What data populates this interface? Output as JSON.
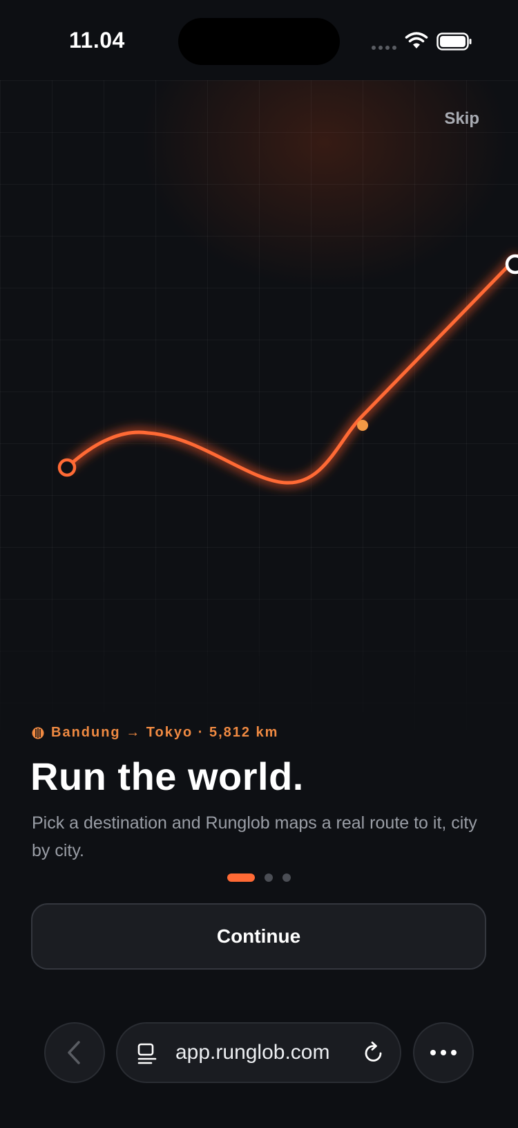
{
  "status_bar": {
    "time": "11.04"
  },
  "header": {
    "skip_label": "Skip"
  },
  "onboarding": {
    "route_meta": "Bandung → Tokyo · 5,812 km",
    "headline": "Run the world.",
    "description": "Pick a destination and Runglob maps a real route to it, city by city.",
    "pager": {
      "total_pages": 3,
      "current_page": 1
    },
    "continue_label": "Continue"
  },
  "browser": {
    "url": "app.runglob.com",
    "icons": {
      "back": "chevron-left-icon",
      "tabs": "tabs-icon",
      "reload": "reload-icon",
      "more": "ellipsis-icon"
    }
  },
  "colors": {
    "accent": "#ff6a35",
    "accent_text": "#f08a42",
    "background": "#0e1014",
    "button_bg": "#1b1d22"
  }
}
